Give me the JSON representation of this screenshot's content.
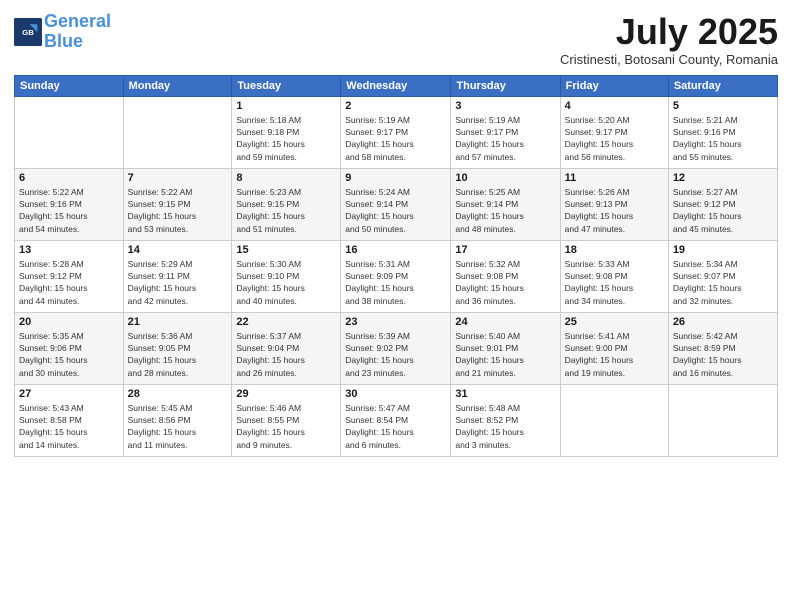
{
  "header": {
    "logo_line1": "General",
    "logo_line2": "Blue",
    "month": "July 2025",
    "location": "Cristinesti, Botosani County, Romania"
  },
  "days_of_week": [
    "Sunday",
    "Monday",
    "Tuesday",
    "Wednesday",
    "Thursday",
    "Friday",
    "Saturday"
  ],
  "weeks": [
    [
      {
        "day": "",
        "info": ""
      },
      {
        "day": "",
        "info": ""
      },
      {
        "day": "1",
        "info": "Sunrise: 5:18 AM\nSunset: 9:18 PM\nDaylight: 15 hours\nand 59 minutes."
      },
      {
        "day": "2",
        "info": "Sunrise: 5:19 AM\nSunset: 9:17 PM\nDaylight: 15 hours\nand 58 minutes."
      },
      {
        "day": "3",
        "info": "Sunrise: 5:19 AM\nSunset: 9:17 PM\nDaylight: 15 hours\nand 57 minutes."
      },
      {
        "day": "4",
        "info": "Sunrise: 5:20 AM\nSunset: 9:17 PM\nDaylight: 15 hours\nand 56 minutes."
      },
      {
        "day": "5",
        "info": "Sunrise: 5:21 AM\nSunset: 9:16 PM\nDaylight: 15 hours\nand 55 minutes."
      }
    ],
    [
      {
        "day": "6",
        "info": "Sunrise: 5:22 AM\nSunset: 9:16 PM\nDaylight: 15 hours\nand 54 minutes."
      },
      {
        "day": "7",
        "info": "Sunrise: 5:22 AM\nSunset: 9:15 PM\nDaylight: 15 hours\nand 53 minutes."
      },
      {
        "day": "8",
        "info": "Sunrise: 5:23 AM\nSunset: 9:15 PM\nDaylight: 15 hours\nand 51 minutes."
      },
      {
        "day": "9",
        "info": "Sunrise: 5:24 AM\nSunset: 9:14 PM\nDaylight: 15 hours\nand 50 minutes."
      },
      {
        "day": "10",
        "info": "Sunrise: 5:25 AM\nSunset: 9:14 PM\nDaylight: 15 hours\nand 48 minutes."
      },
      {
        "day": "11",
        "info": "Sunrise: 5:26 AM\nSunset: 9:13 PM\nDaylight: 15 hours\nand 47 minutes."
      },
      {
        "day": "12",
        "info": "Sunrise: 5:27 AM\nSunset: 9:12 PM\nDaylight: 15 hours\nand 45 minutes."
      }
    ],
    [
      {
        "day": "13",
        "info": "Sunrise: 5:28 AM\nSunset: 9:12 PM\nDaylight: 15 hours\nand 44 minutes."
      },
      {
        "day": "14",
        "info": "Sunrise: 5:29 AM\nSunset: 9:11 PM\nDaylight: 15 hours\nand 42 minutes."
      },
      {
        "day": "15",
        "info": "Sunrise: 5:30 AM\nSunset: 9:10 PM\nDaylight: 15 hours\nand 40 minutes."
      },
      {
        "day": "16",
        "info": "Sunrise: 5:31 AM\nSunset: 9:09 PM\nDaylight: 15 hours\nand 38 minutes."
      },
      {
        "day": "17",
        "info": "Sunrise: 5:32 AM\nSunset: 9:08 PM\nDaylight: 15 hours\nand 36 minutes."
      },
      {
        "day": "18",
        "info": "Sunrise: 5:33 AM\nSunset: 9:08 PM\nDaylight: 15 hours\nand 34 minutes."
      },
      {
        "day": "19",
        "info": "Sunrise: 5:34 AM\nSunset: 9:07 PM\nDaylight: 15 hours\nand 32 minutes."
      }
    ],
    [
      {
        "day": "20",
        "info": "Sunrise: 5:35 AM\nSunset: 9:06 PM\nDaylight: 15 hours\nand 30 minutes."
      },
      {
        "day": "21",
        "info": "Sunrise: 5:36 AM\nSunset: 9:05 PM\nDaylight: 15 hours\nand 28 minutes."
      },
      {
        "day": "22",
        "info": "Sunrise: 5:37 AM\nSunset: 9:04 PM\nDaylight: 15 hours\nand 26 minutes."
      },
      {
        "day": "23",
        "info": "Sunrise: 5:39 AM\nSunset: 9:02 PM\nDaylight: 15 hours\nand 23 minutes."
      },
      {
        "day": "24",
        "info": "Sunrise: 5:40 AM\nSunset: 9:01 PM\nDaylight: 15 hours\nand 21 minutes."
      },
      {
        "day": "25",
        "info": "Sunrise: 5:41 AM\nSunset: 9:00 PM\nDaylight: 15 hours\nand 19 minutes."
      },
      {
        "day": "26",
        "info": "Sunrise: 5:42 AM\nSunset: 8:59 PM\nDaylight: 15 hours\nand 16 minutes."
      }
    ],
    [
      {
        "day": "27",
        "info": "Sunrise: 5:43 AM\nSunset: 8:58 PM\nDaylight: 15 hours\nand 14 minutes."
      },
      {
        "day": "28",
        "info": "Sunrise: 5:45 AM\nSunset: 8:56 PM\nDaylight: 15 hours\nand 11 minutes."
      },
      {
        "day": "29",
        "info": "Sunrise: 5:46 AM\nSunset: 8:55 PM\nDaylight: 15 hours\nand 9 minutes."
      },
      {
        "day": "30",
        "info": "Sunrise: 5:47 AM\nSunset: 8:54 PM\nDaylight: 15 hours\nand 6 minutes."
      },
      {
        "day": "31",
        "info": "Sunrise: 5:48 AM\nSunset: 8:52 PM\nDaylight: 15 hours\nand 3 minutes."
      },
      {
        "day": "",
        "info": ""
      },
      {
        "day": "",
        "info": ""
      }
    ]
  ]
}
